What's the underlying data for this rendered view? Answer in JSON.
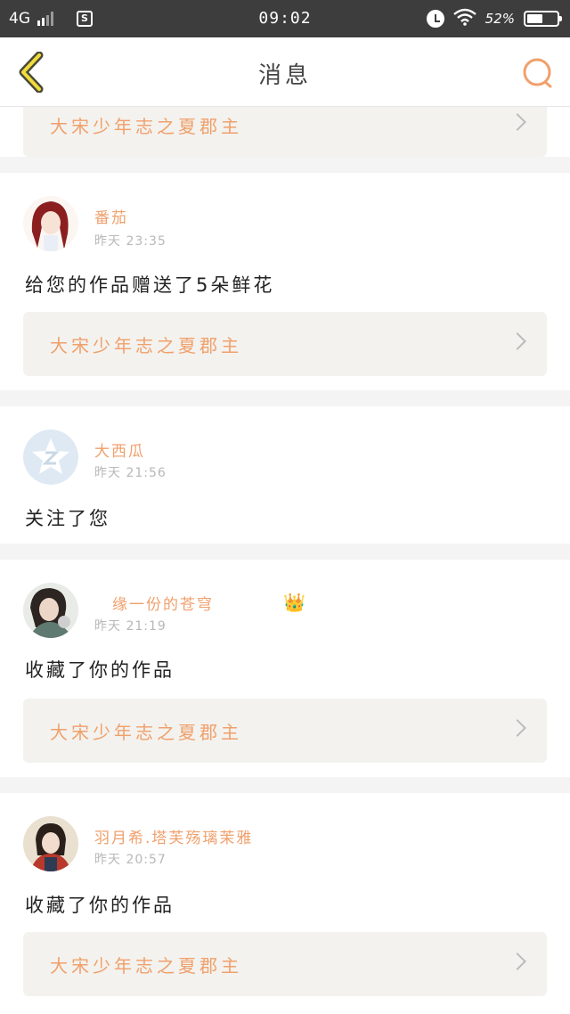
{
  "status_bar": {
    "network": "4G",
    "sim_icon": "S",
    "time": "09:02",
    "battery_percent": "52%",
    "battery_level": 0.52,
    "icons": [
      "signal-icon",
      "sim-icon",
      "alarm-icon",
      "wifi-icon",
      "battery-icon"
    ]
  },
  "header": {
    "title": "消息",
    "back_icon": "chevron-left-icon",
    "search_icon": "search-icon",
    "accent_color": "#f0a06c"
  },
  "feed": {
    "partial_work_title": "大宋少年志之夏郡主",
    "items": [
      {
        "user": "番茄",
        "time": "昨天 23:35",
        "text": "给您的作品赠送了5朵鲜花",
        "work": "大宋少年志之夏郡主"
      },
      {
        "user": "大西瓜",
        "time": "昨天 21:56",
        "text": "关注了您"
      },
      {
        "user": "缘一份的苍穹",
        "badge": "👑",
        "time": "昨天 21:19",
        "text": "收藏了你的作品",
        "work": "大宋少年志之夏郡主"
      },
      {
        "user": "羽月希.塔芙殇璃茉雅",
        "time": "昨天 20:57",
        "text": "收藏了你的作品",
        "work": "大宋少年志之夏郡主"
      }
    ]
  }
}
